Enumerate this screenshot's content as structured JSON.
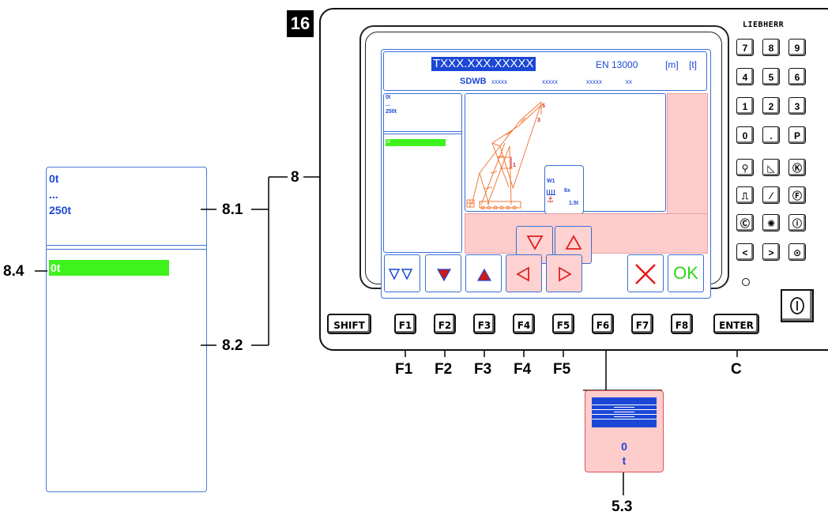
{
  "labels": {
    "l8": "8",
    "l8_1": "8.1",
    "l8_2": "8.2",
    "l8_4": "8.4",
    "l5_3": "5.3",
    "l16": "16",
    "f1": "F1",
    "f2": "F2",
    "f3": "F3",
    "f4": "F4",
    "f5": "F5",
    "c": "C"
  },
  "zoom_panel": {
    "top_value": "0t",
    "dots": "...",
    "bottom_value": "250t",
    "bar_value": "0t"
  },
  "screen": {
    "title": "TXXX.XXX.XXXXX",
    "norm": "EN 13000",
    "unit_m": "[m]",
    "unit_t": "[t]",
    "mode": "SDWB",
    "x1": "xxxxx",
    "x2": "xxxxx",
    "x3": "xxxxx",
    "x4": "xx",
    "panel_top": "0t",
    "panel_dots": "...",
    "panel_bottom": "250t",
    "panel_bar": "0t",
    "winch": "W1",
    "reeving": "6x",
    "load": "1.5t",
    "mark5": "5",
    "mark3": "3",
    "mark1": "1",
    "ok": "OK"
  },
  "function_keys": [
    "SHIFT",
    "F1",
    "F2",
    "F3",
    "F4",
    "F5",
    "F6",
    "F7",
    "F8",
    "ENTER"
  ],
  "brand": "LIEBHERR",
  "keypad": [
    "7",
    "8",
    "9",
    "4",
    "5",
    "6",
    "1",
    "2",
    "3",
    "0",
    ".",
    "P"
  ],
  "dev53": {
    "value": "0",
    "unit": "t"
  },
  "colors": {
    "screen_blue": "#1c47d6",
    "bar_green": "#3ef21e",
    "pink": "#ffcccc",
    "crane_orange": "#f07a3a"
  }
}
